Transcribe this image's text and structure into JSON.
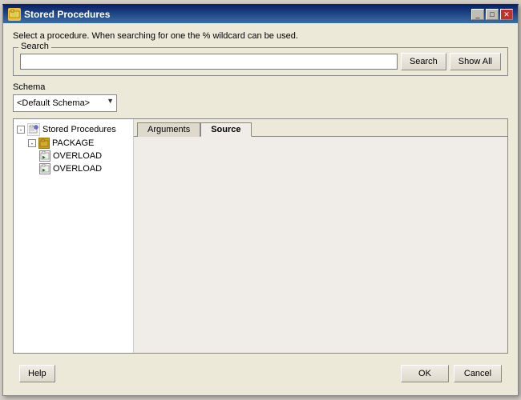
{
  "window": {
    "title": "Stored Procedures",
    "title_icon": "⚙",
    "minimize_label": "_",
    "maximize_label": "□",
    "close_label": "✕"
  },
  "hint": {
    "text": "Select a procedure. When searching for one the % wildcard can be used."
  },
  "search": {
    "group_label": "Search",
    "input_value": "",
    "input_placeholder": "",
    "search_button": "Search",
    "show_all_button": "Show All"
  },
  "schema": {
    "label": "Schema",
    "default_option": "<Default Schema>",
    "options": [
      "<Default Schema>"
    ]
  },
  "tree": {
    "root_label": "Stored Procedures",
    "items": [
      {
        "label": "PACKAGE",
        "type": "package",
        "expanded": true
      },
      {
        "label": "OVERLOAD",
        "type": "proc"
      },
      {
        "label": "OVERLOAD",
        "type": "proc"
      }
    ]
  },
  "tabs": [
    {
      "label": "Arguments",
      "active": false
    },
    {
      "label": "Source",
      "active": true
    }
  ],
  "footer": {
    "help_button": "Help",
    "ok_button": "OK",
    "cancel_button": "Cancel"
  }
}
